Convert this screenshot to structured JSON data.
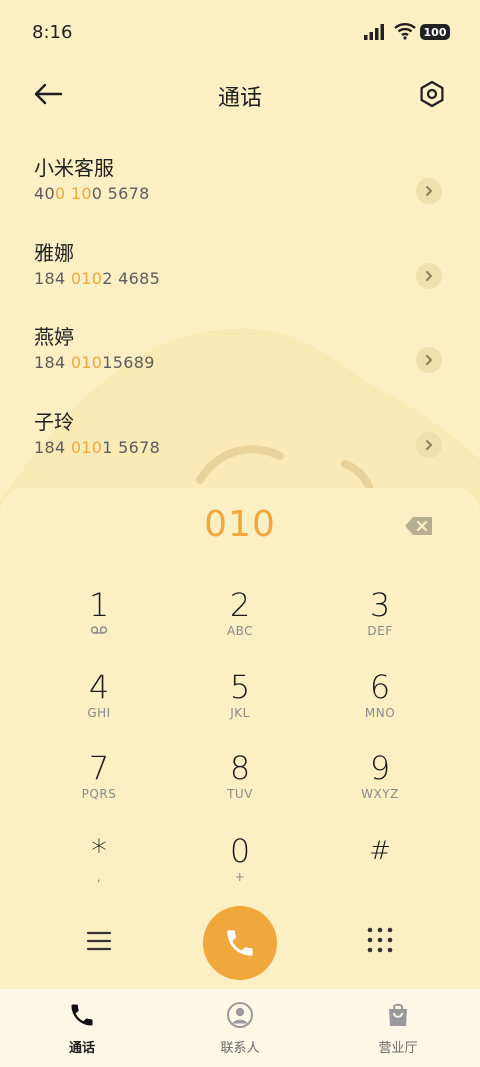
{
  "status_bar": {
    "time": "8:16",
    "battery": "100"
  },
  "header": {
    "title": "通话"
  },
  "contacts": [
    {
      "name": "小米客服",
      "number_parts": [
        "40",
        "0 10",
        "0 5678"
      ]
    },
    {
      "name": "雅娜",
      "number_parts": [
        "184 ",
        "010",
        "2 4685"
      ]
    },
    {
      "name": "燕婷",
      "number_parts": [
        "184 ",
        "010",
        "15689"
      ]
    },
    {
      "name": "子玲",
      "number_parts": [
        "184 ",
        "010",
        "1 5678"
      ]
    }
  ],
  "dialer": {
    "input": "010",
    "keys": [
      {
        "digit": "1",
        "letters": "voicemail-icon"
      },
      {
        "digit": "2",
        "letters": "ABC"
      },
      {
        "digit": "3",
        "letters": "DEF"
      },
      {
        "digit": "4",
        "letters": "GHI"
      },
      {
        "digit": "5",
        "letters": "JKL"
      },
      {
        "digit": "6",
        "letters": "MNO"
      },
      {
        "digit": "7",
        "letters": "PQRS"
      },
      {
        "digit": "8",
        "letters": "TUV"
      },
      {
        "digit": "9",
        "letters": "WXYZ"
      },
      {
        "digit": "*",
        "letters": ","
      },
      {
        "digit": "0",
        "letters": "+"
      },
      {
        "digit": "#",
        "letters": ""
      }
    ]
  },
  "bottom_nav": [
    {
      "label": "通话",
      "icon": "phone-icon",
      "active": true
    },
    {
      "label": "联系人",
      "icon": "contact-icon",
      "active": false
    },
    {
      "label": "营业厅",
      "icon": "shopping-bag-icon",
      "active": false
    }
  ],
  "colors": {
    "background": "#fcefc3",
    "accent": "#f0a73b",
    "nav_background": "#fdf8e6"
  }
}
